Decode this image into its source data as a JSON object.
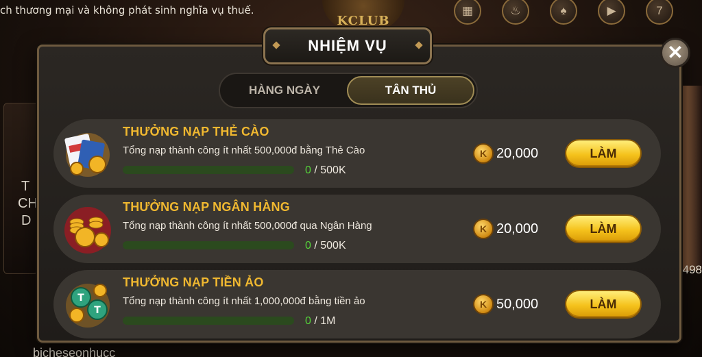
{
  "background": {
    "ticker_text": "ch thương mại và không phát sinh nghĩa vụ thuế.",
    "logo_text": "KCLUB",
    "right_number": "498",
    "bottom_name": "bicheseonhucc",
    "left_letters": [
      "T",
      "CH",
      "D"
    ]
  },
  "topbar": {
    "icons": [
      "grid-icon",
      "fire-icon",
      "cards-icon",
      "video-icon",
      "slot-icon"
    ]
  },
  "modal": {
    "title": "NHIỆM VỤ",
    "close_label": "✕",
    "tabs": [
      {
        "label": "HÀNG NGÀY",
        "active": false
      },
      {
        "label": "TÂN THỦ",
        "active": true
      }
    ],
    "tasks": [
      {
        "title": "THƯỞNG NẠP THẺ CÀO",
        "description": "Tổng nạp thành công ít nhất 500,000đ bằng Thẻ Cào",
        "progress_current": "0",
        "progress_sep": " / ",
        "progress_target": "500K",
        "progress_fraction": 0,
        "coin_letter": "K",
        "reward": "20,000",
        "button_label": "LÀM",
        "icon": "scratch-card-icon"
      },
      {
        "title": "THƯỞNG NẠP NGÂN HÀNG",
        "description": "Tổng nạp thành công ít nhất 500,000đ qua Ngân Hàng",
        "progress_current": "0",
        "progress_sep": " / ",
        "progress_target": "500K",
        "progress_fraction": 0,
        "coin_letter": "K",
        "reward": "20,000",
        "button_label": "LÀM",
        "icon": "bank-coins-icon"
      },
      {
        "title": "THƯỞNG NẠP TIỀN ẢO",
        "description": "Tổng nạp thành công ít nhất 1,000,000đ bằng tiền ảo",
        "progress_current": "0",
        "progress_sep": " / ",
        "progress_target": "1M",
        "progress_fraction": 0,
        "coin_letter": "K",
        "reward": "50,000",
        "button_label": "LÀM",
        "icon": "crypto-coins-icon"
      }
    ]
  },
  "colors": {
    "title_gold": "#f0b830",
    "progress_green": "#55d43a",
    "button_gold": "#f5c21c"
  }
}
